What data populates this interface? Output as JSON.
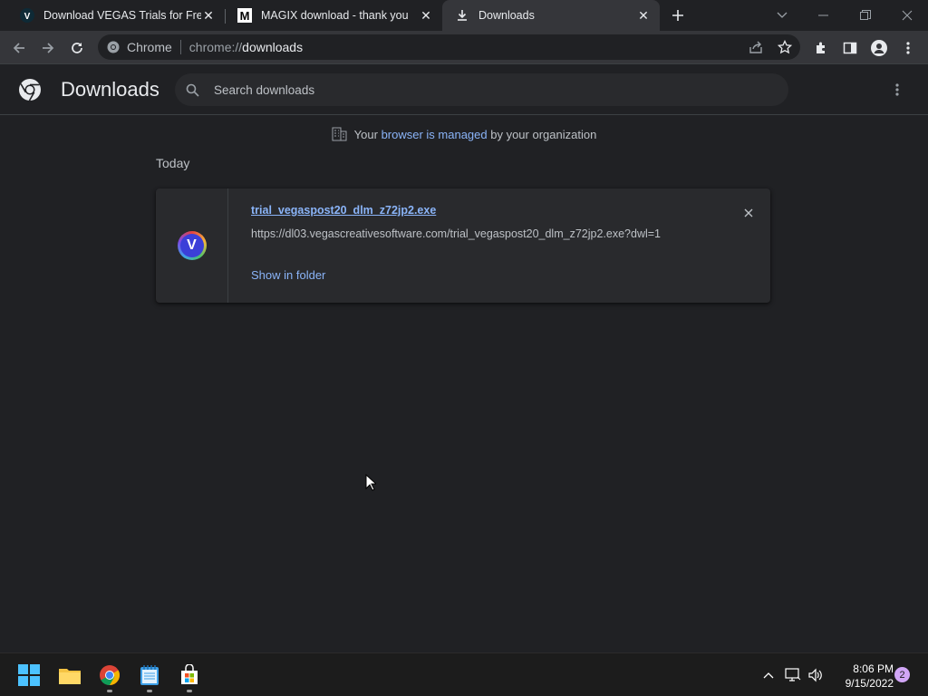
{
  "tabs": [
    {
      "title": "Download VEGAS Trials for Free |",
      "favicon": "vegas-favicon"
    },
    {
      "title": "MAGIX download - thank you",
      "favicon": "magix-favicon"
    },
    {
      "title": "Downloads",
      "favicon": "download-icon"
    }
  ],
  "toolbar": {
    "omnibox_label": "Chrome",
    "url_scheme": "chrome://",
    "url_host": "downloads"
  },
  "downloads": {
    "title": "Downloads",
    "search_placeholder": "Search downloads",
    "managed_prefix": "Your ",
    "managed_link": "browser is managed",
    "managed_suffix": " by your organization",
    "section_date": "Today",
    "items": [
      {
        "icon_letter": "V",
        "file_name": "trial_vegaspost20_dlm_z72jp2.exe",
        "url": "https://dl03.vegascreativesoftware.com/trial_vegaspost20_dlm_z72jp2.exe?dwl=1",
        "action": "Show in folder"
      }
    ]
  },
  "taskbar": {
    "time": "8:06 PM",
    "date": "9/15/2022",
    "notification_count": "2"
  },
  "colors": {
    "accent_link": "#8ab4f8",
    "background": "#202124",
    "card": "#292a2d"
  }
}
